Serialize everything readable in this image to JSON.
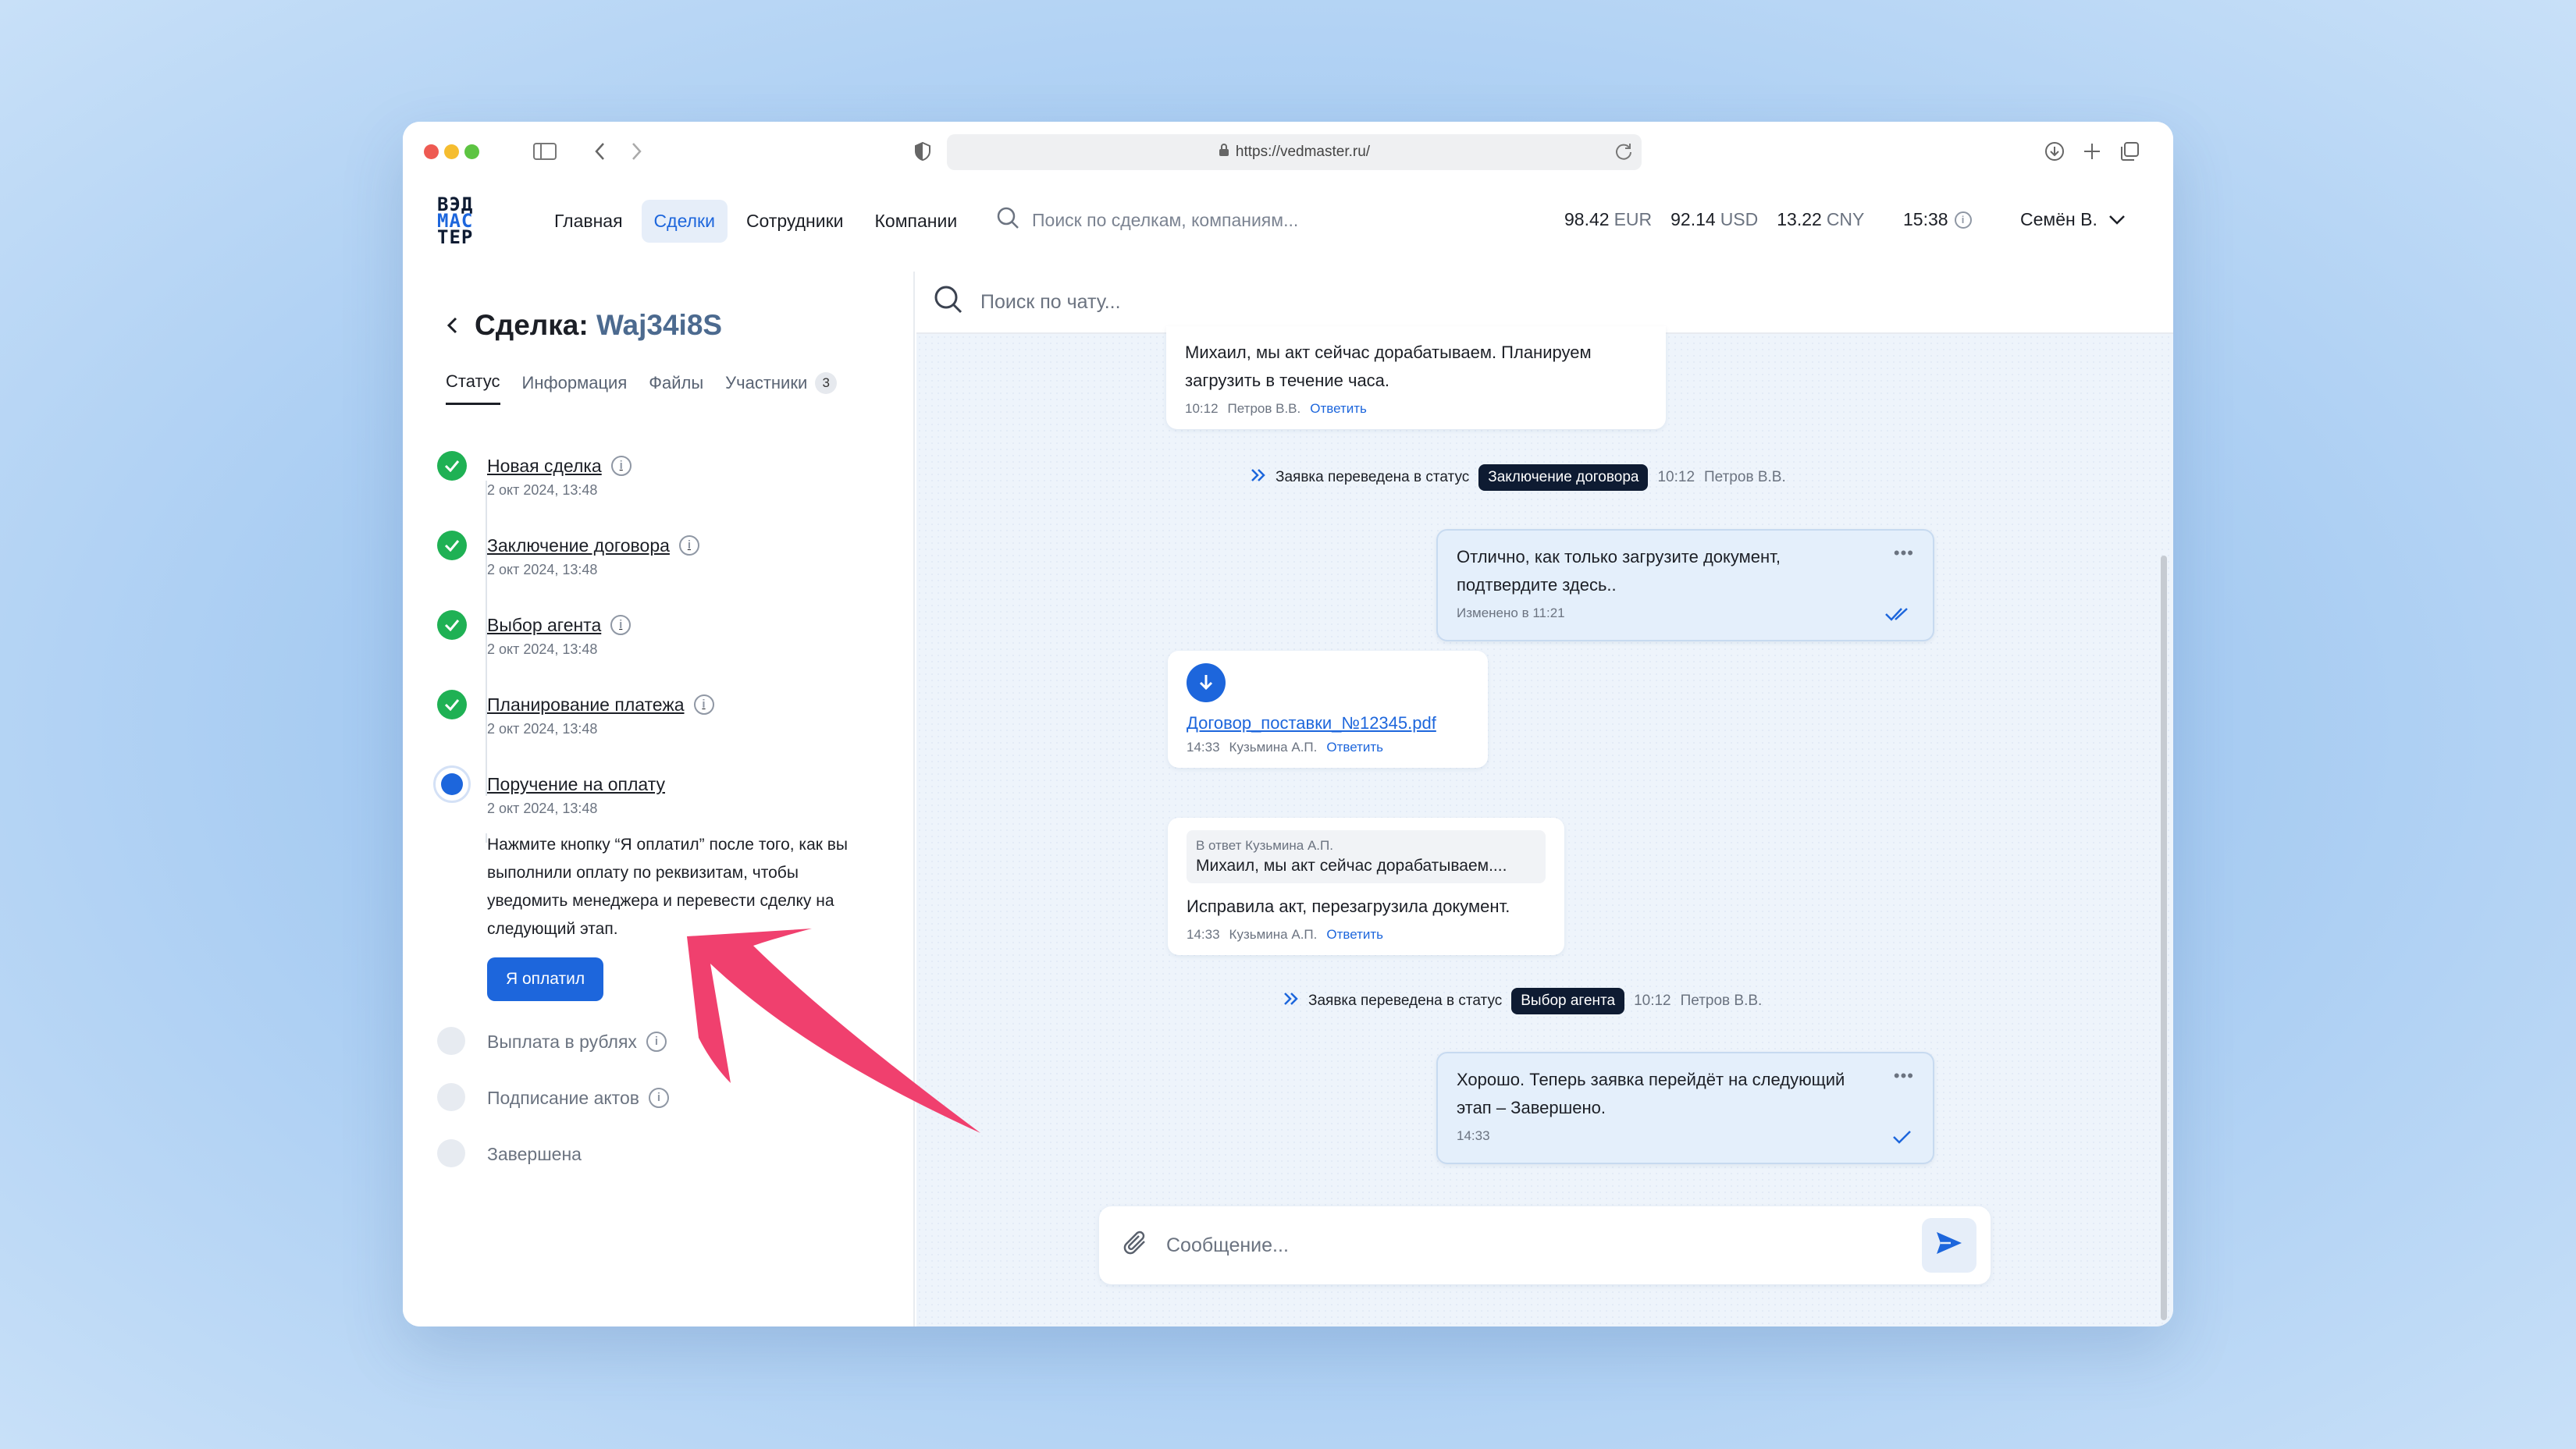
{
  "browser": {
    "url": "https://vedmaster.ru/"
  },
  "header": {
    "logo": [
      "ВЭД",
      "МАС",
      "ТЕР"
    ],
    "nav": [
      {
        "label": "Главная",
        "active": false
      },
      {
        "label": "Сделки",
        "active": true
      },
      {
        "label": "Сотрудники",
        "active": false
      },
      {
        "label": "Компании",
        "active": false
      }
    ],
    "search_placeholder": "Поиск по сделкам, компаниям...",
    "rates": [
      {
        "value": "98.42",
        "currency": "EUR"
      },
      {
        "value": "92.14",
        "currency": "USD"
      },
      {
        "value": "13.22",
        "currency": "CNY"
      }
    ],
    "time": "15:38",
    "user": "Семён В."
  },
  "deal": {
    "title_prefix": "Сделка:",
    "id": "Waj34i8S",
    "tabs": [
      {
        "label": "Статус",
        "active": true
      },
      {
        "label": "Информация",
        "active": false
      },
      {
        "label": "Файлы",
        "active": false
      },
      {
        "label": "Участники",
        "active": false,
        "badge": "3"
      }
    ],
    "steps": [
      {
        "name": "Новая сделка",
        "date": "2 окт 2024, 13:48",
        "state": "done"
      },
      {
        "name": "Заключение договора",
        "date": "2 окт 2024, 13:48",
        "state": "done"
      },
      {
        "name": "Выбор агента",
        "date": "2 окт 2024, 13:48",
        "state": "done"
      },
      {
        "name": "Планирование платежа",
        "date": "2 окт 2024, 13:48",
        "state": "done"
      },
      {
        "name": "Поручение на оплату",
        "date": "2 окт 2024, 13:48",
        "state": "current"
      },
      {
        "name": "Выплата в рублях",
        "state": "pending"
      },
      {
        "name": "Подписание актов",
        "state": "pending"
      },
      {
        "name": "Завершена",
        "state": "pending"
      }
    ],
    "current_desc": "Нажмите кнопку “Я оплатил” после того, как вы выполнили оплату по реквизитам, чтобы уведомить менеджера и перевести сделку на следующий этап.",
    "paid_button": "Я оплатил"
  },
  "chat": {
    "search_placeholder": "Поиск по чату...",
    "reply_label": "Ответить",
    "m1": {
      "text": "Михаил, мы акт сейчас дорабатываем. Планируем загрузить в течение часа.",
      "time": "10:12",
      "author": "Петров В.В."
    },
    "s1": {
      "prefix": "Заявка переведена в статус",
      "status": "Заключение договора",
      "time": "10:12",
      "author": "Петров В.В."
    },
    "m2": {
      "text": "Отлично, как только загрузите документ, подтвердите здесь..",
      "edited": "Изменено в 11:21"
    },
    "m3": {
      "file": "Договор_поставки_№12345.pdf",
      "time": "14:33",
      "author": "Кузьмина А.П."
    },
    "m4": {
      "quote_author": "В ответ Кузьмина А.П.",
      "quote_text": "Михаил, мы акт сейчас дорабатываем....",
      "text": "Исправила акт, перезагрузила документ.",
      "time": "14:33",
      "author": "Кузьмина А.П."
    },
    "s2": {
      "prefix": "Заявка переведена в статус",
      "status": "Выбор агента",
      "time": "10:12",
      "author": "Петров В.В."
    },
    "m5": {
      "text": "Хорошо. Теперь заявка перейдёт на следующий этап – Завершено.",
      "time": "14:33"
    },
    "composer_placeholder": "Сообщение..."
  },
  "colors": {
    "accent": "#1d66dc",
    "done": "#1fb154",
    "annotation_arrow": "#f0406e"
  }
}
